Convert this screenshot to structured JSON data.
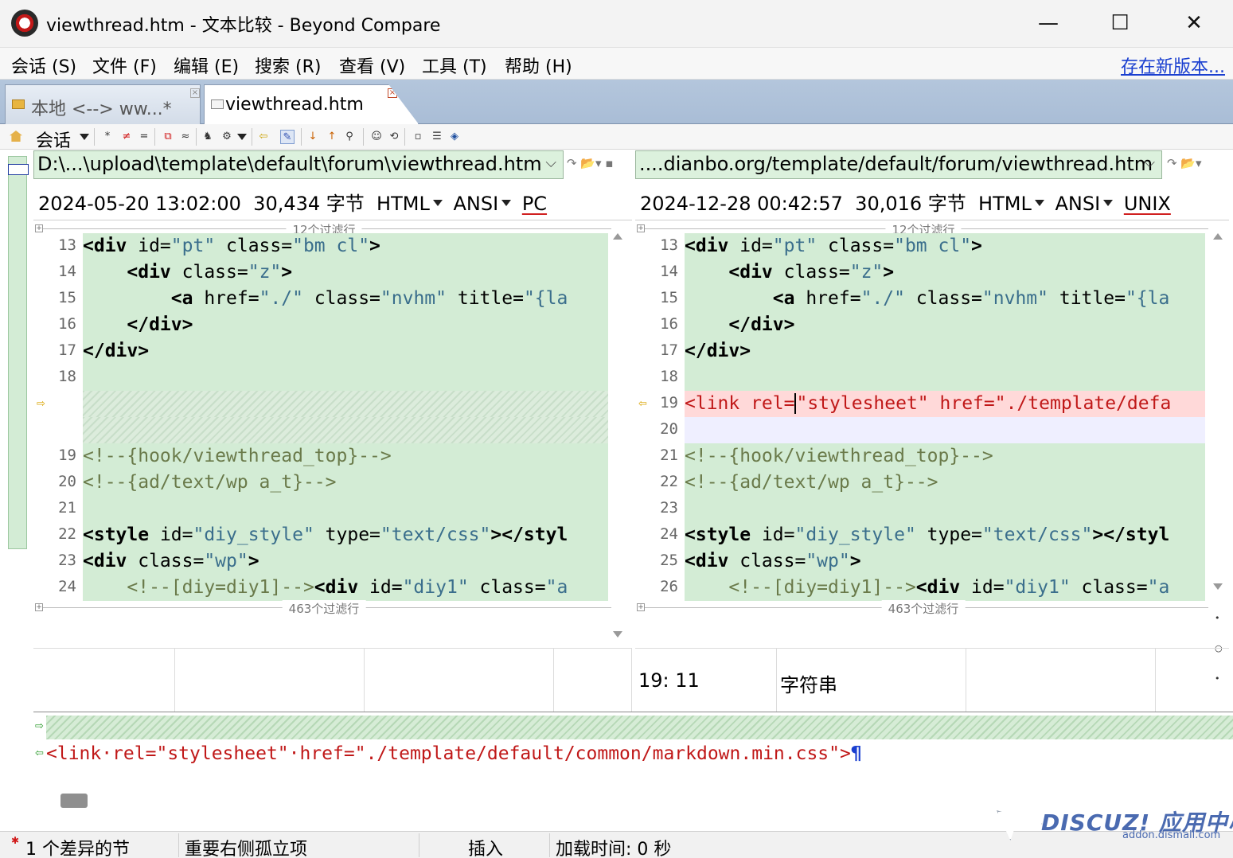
{
  "window": {
    "title": "viewthread.htm - 文本比较 - Beyond Compare",
    "minimize_glyph": "—",
    "maximize_glyph": "☐",
    "close_glyph": "✕"
  },
  "menu": {
    "items": [
      "会话 (S)",
      "文件 (F)",
      "编辑 (E)",
      "搜索 (R)",
      "查看 (V)",
      "工具 (T)",
      "帮助 (H)"
    ],
    "update_link": "存在新版本..."
  },
  "tabs": [
    {
      "label": "本地 <--> ww...*",
      "icon": "folder-icon",
      "active": false
    },
    {
      "label": "viewthread.htm",
      "icon": "document-icon",
      "active": true
    }
  ],
  "toolbar": {
    "session_label": "会话"
  },
  "left": {
    "path": "D:\\...\\upload\\template\\default\\forum\\viewthread.htm",
    "timestamp": "2024-05-20 13:02:00",
    "size": "30,434 字节",
    "format": "HTML",
    "encoding": "ANSI",
    "line_ending": "PC",
    "filter_top": "12个过滤行",
    "filter_bottom": "463个过滤行",
    "lines": [
      {
        "n": "13",
        "html": "<span class='tag'>&lt;div</span> id=<span class='str'>\"pt\"</span> class=<span class='str'>\"bm cl\"</span><span class='tag'>&gt;</span>"
      },
      {
        "n": "14",
        "html": "    <span class='tag'>&lt;div</span> class=<span class='str'>\"z\"</span><span class='tag'>&gt;</span>"
      },
      {
        "n": "15",
        "html": "        <span class='tag'>&lt;a</span> href=<span class='str'>\"./\"</span> class=<span class='str'>\"nvhm\"</span> title=<span class='str'>\"{la</span>"
      },
      {
        "n": "16",
        "html": "    <span class='tag'>&lt;/div&gt;</span>"
      },
      {
        "n": "17",
        "html": "<span class='tag'>&lt;/div&gt;</span>"
      },
      {
        "n": "18",
        "html": ""
      },
      {
        "n": "",
        "html": "",
        "kind": "hatch"
      },
      {
        "n": "",
        "html": "",
        "kind": "hatch"
      },
      {
        "n": "19",
        "html": "<span class='com'>&lt;!--{hook/viewthread_top}--&gt;</span>"
      },
      {
        "n": "20",
        "html": "<span class='com'>&lt;!--{ad/text/wp a_t}--&gt;</span>"
      },
      {
        "n": "21",
        "html": ""
      },
      {
        "n": "22",
        "html": "<span class='tag'>&lt;style</span> id=<span class='str'>\"diy_style\"</span> type=<span class='str'>\"text/css\"</span><span class='tag'>&gt;&lt;/styl</span>"
      },
      {
        "n": "23",
        "html": "<span class='tag'>&lt;div</span> class=<span class='str'>\"wp\"</span><span class='tag'>&gt;</span>"
      },
      {
        "n": "24",
        "html": "    <span class='com'>&lt;!--[diy=diy1]--&gt;</span><span class='tag'>&lt;div</span> id=<span class='str'>\"diy1\"</span> class=<span class='str'>\"a</span>"
      }
    ],
    "status": [
      "",
      "",
      "",
      ""
    ]
  },
  "right": {
    "path": "....dianbo.org/template/default/forum/viewthread.htm",
    "timestamp": "2024-12-28 00:42:57",
    "size": "30,016 字节",
    "format": "HTML",
    "encoding": "ANSI",
    "line_ending": "UNIX",
    "filter_top": "12个过滤行",
    "filter_bottom": "463个过滤行",
    "lines": [
      {
        "n": "13",
        "html": "<span class='tag'>&lt;div</span> id=<span class='str'>\"pt\"</span> class=<span class='str'>\"bm cl\"</span><span class='tag'>&gt;</span>"
      },
      {
        "n": "14",
        "html": "    <span class='tag'>&lt;div</span> class=<span class='str'>\"z\"</span><span class='tag'>&gt;</span>"
      },
      {
        "n": "15",
        "html": "        <span class='tag'>&lt;a</span> href=<span class='str'>\"./\"</span> class=<span class='str'>\"nvhm\"</span> title=<span class='str'>\"{la</span>"
      },
      {
        "n": "16",
        "html": "    <span class='tag'>&lt;/div&gt;</span>"
      },
      {
        "n": "17",
        "html": "<span class='tag'>&lt;/div&gt;</span>"
      },
      {
        "n": "18",
        "html": ""
      },
      {
        "n": "19",
        "html": "&lt;link rel=<span style='border-left:2px solid #000'>\"stylesheet\"</span> href=\"./template/defa",
        "kind": "diff"
      },
      {
        "n": "20",
        "html": "",
        "kind": "gap"
      },
      {
        "n": "21",
        "html": "<span class='com'>&lt;!--{hook/viewthread_top}--&gt;</span>"
      },
      {
        "n": "22",
        "html": "<span class='com'>&lt;!--{ad/text/wp a_t}--&gt;</span>"
      },
      {
        "n": "23",
        "html": ""
      },
      {
        "n": "24",
        "html": "<span class='tag'>&lt;style</span> id=<span class='str'>\"diy_style\"</span> type=<span class='str'>\"text/css\"</span><span class='tag'>&gt;&lt;/styl</span>"
      },
      {
        "n": "25",
        "html": "<span class='tag'>&lt;div</span> class=<span class='str'>\"wp\"</span><span class='tag'>&gt;</span>"
      },
      {
        "n": "26",
        "html": "    <span class='com'>&lt;!--[diy=diy1]--&gt;</span><span class='tag'>&lt;div</span> id=<span class='str'>\"diy1\"</span> class=<span class='str'>\"a</span>"
      }
    ],
    "cursor_pos": "19: 11",
    "token_type": "字符串"
  },
  "bottom": {
    "line2": "<link·rel=\"stylesheet\"·href=\"./template/default/common/markdown.min.css\">",
    "pilcrow": "¶"
  },
  "statusbar": {
    "diff_count": "1 个差异的节",
    "orphan": "重要右侧孤立项",
    "mode": "插入",
    "load_time": "加载时间:  0 秒"
  },
  "watermark": {
    "brand": "DISCUZ! 应用中心",
    "url": "addon.dismall.com"
  },
  "colors": {
    "match_bg": "#d3ecd5",
    "diff_bg": "#ffd9d9",
    "diff_text": "#c01818",
    "link": "#1a3fd0"
  }
}
